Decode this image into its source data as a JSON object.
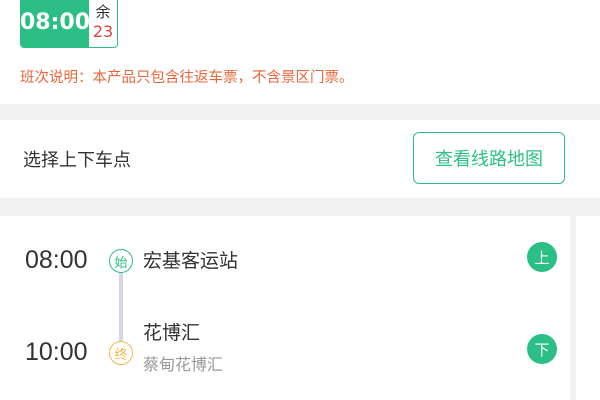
{
  "schedule": {
    "time": "08:00",
    "remaining_label": "余",
    "remaining_count": "23"
  },
  "notice": "班次说明：本产品只包含往返车票，不含景区门票。",
  "stops_section": {
    "title": "选择上下车点",
    "map_button_label": "查看线路地图"
  },
  "stops": [
    {
      "time": "08:00",
      "marker": "始",
      "name": "宏基客运站",
      "sub": "",
      "action": "上"
    },
    {
      "time": "10:00",
      "marker": "终",
      "name": "花博汇",
      "sub": "蔡甸花博汇",
      "action": "下"
    }
  ],
  "colors": {
    "accent": "#2bbf86",
    "warning": "#e8673a",
    "end_marker": "#f0b84a",
    "count": "#e0433b"
  }
}
